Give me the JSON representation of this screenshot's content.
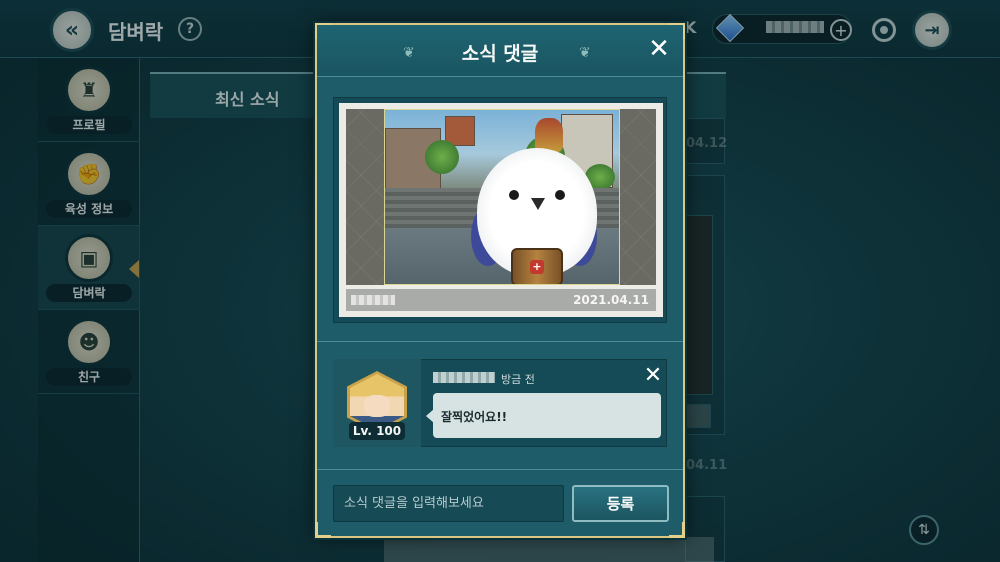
{
  "header": {
    "title": "담벼락",
    "help_label": "?",
    "resource_suffix": "K",
    "add_label": "+"
  },
  "sidebar": {
    "items": [
      {
        "label": "프로필",
        "icon": "helmet-icon"
      },
      {
        "label": "육성 정보",
        "icon": "fist-icon"
      },
      {
        "label": "담벼락",
        "icon": "chat-board-icon"
      },
      {
        "label": "친구",
        "icon": "friends-icon"
      }
    ]
  },
  "feed": {
    "active_tab": "최신 소식",
    "date_1": "04.12",
    "date_2": "04.11"
  },
  "modal": {
    "title": "소식 댓글",
    "close_label": "✕",
    "post": {
      "date": "2021.04.11"
    },
    "comment": {
      "level": "Lv. 100",
      "time": "방금 전",
      "text": "잘찍었어요!!",
      "delete_label": "✕"
    },
    "input": {
      "placeholder": "소식 댓글을 입력해보세요",
      "value": ""
    },
    "submit_label": "등록"
  },
  "colors": {
    "modal_bg": "#1d5c68",
    "modal_border": "#d9c782",
    "bubble": "#d7e3e2",
    "accent_gold": "#c9a24a"
  }
}
